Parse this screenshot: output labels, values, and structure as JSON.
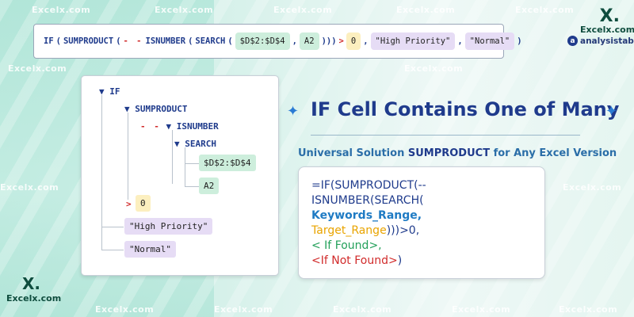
{
  "formula_bar": {
    "fn_if": "IF",
    "p1": "(",
    "fn_sumproduct": "SUMPRODUCT",
    "p2": "(",
    "dashes": "- -",
    "fn_isnumber": "ISNUMBER",
    "p3": "(",
    "fn_search": "SEARCH",
    "p4": "(",
    "range_d": "$D$2:$D$4",
    "comma1": ",",
    "range_a": "A2",
    "close": ")))",
    "gt": ">",
    "zero": "0",
    "comma2": ",",
    "high": "\"High Priority\"",
    "comma3": ",",
    "normal": "\"Normal\"",
    "end": ")"
  },
  "tree": {
    "if": "IF",
    "sumproduct": "SUMPRODUCT",
    "dashes": "- -",
    "isnumber": "ISNUMBER",
    "search": "SEARCH",
    "range_d": "$D$2:$D$4",
    "range_a": "A2",
    "gt": ">",
    "zero": "0",
    "high": "\"High Priority\"",
    "normal": "\"Normal\""
  },
  "headline": {
    "title": "IF Cell Contains One of Many",
    "subtitle_pre": "Universal Solution ",
    "subtitle_bold": "SUMPRODUCT",
    "subtitle_post": " for Any Excel Version"
  },
  "syntax": {
    "line1": "=IF(SUMPRODUCT(--",
    "line2": "ISNUMBER(SEARCH(",
    "line3": "Keywords_Range,",
    "line4a": "Target_Range",
    "line4b": ")))>0,",
    "line5": "< If Found>,",
    "line6a": "<If Not Found>",
    "line6b": ")"
  },
  "branding": {
    "x_mark": "X.",
    "site": "Excelx.com",
    "partner": "analysistabs",
    "partner_mark": "®"
  },
  "watermarks": [
    "Excelx.com",
    "Excelx.com",
    "Excelx.com",
    "Excelx.com",
    "Excelx.com",
    "Excelx.com",
    "Excelx.com",
    "Excelx.com",
    "Excelx.com",
    "Excelx.com",
    "Excelx.com",
    "Excelx.com",
    "Excelx.com",
    "Excelx.com"
  ],
  "colors": {
    "navy": "#1f3b8c",
    "green_chip": "#cdeedc",
    "yellow_chip": "#fcefbf",
    "purple_chip": "#e6dcf5",
    "red": "#d12b2b"
  }
}
